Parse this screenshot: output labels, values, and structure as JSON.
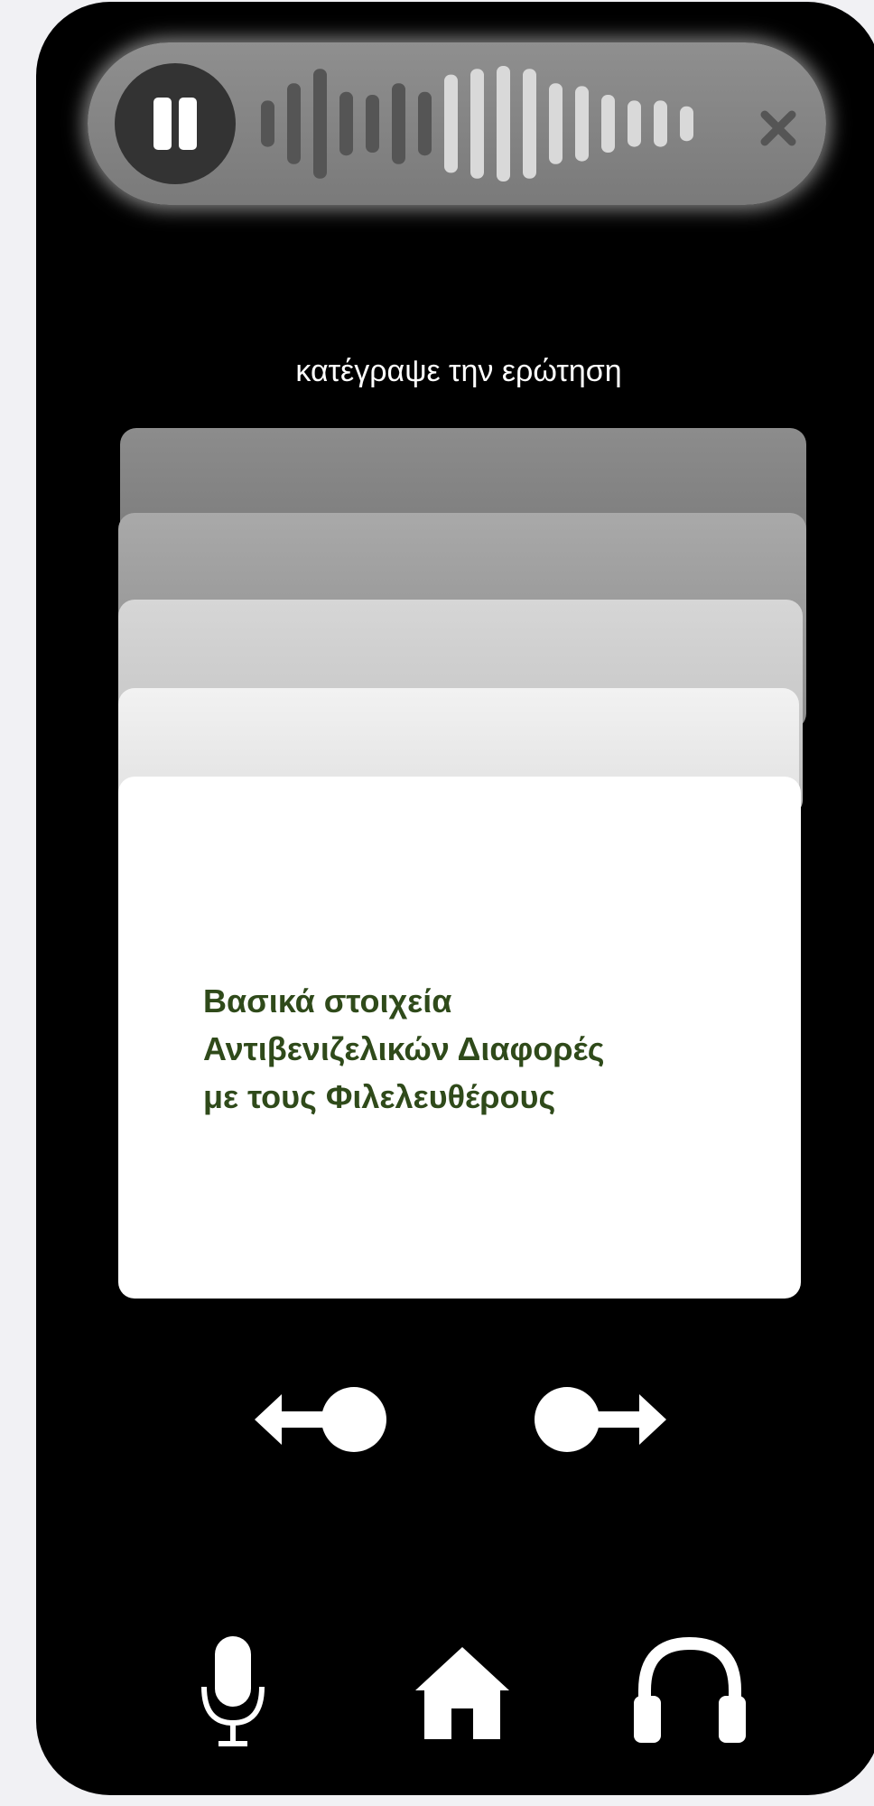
{
  "recorder": {
    "pause_icon": "pause-icon",
    "close_icon": "close-icon",
    "waveform": {
      "bars": [
        {
          "h": 0.4,
          "c": "#555555"
        },
        {
          "h": 0.7,
          "c": "#555555"
        },
        {
          "h": 0.95,
          "c": "#555555"
        },
        {
          "h": 0.55,
          "c": "#555555"
        },
        {
          "h": 0.5,
          "c": "#555555"
        },
        {
          "h": 0.7,
          "c": "#555555"
        },
        {
          "h": 0.55,
          "c": "#555555"
        },
        {
          "h": 0.85,
          "c": "#d9d9d9"
        },
        {
          "h": 0.95,
          "c": "#d9d9d9"
        },
        {
          "h": 1.0,
          "c": "#d9d9d9"
        },
        {
          "h": 0.95,
          "c": "#d9d9d9"
        },
        {
          "h": 0.7,
          "c": "#d9d9d9"
        },
        {
          "h": 0.65,
          "c": "#d9d9d9"
        },
        {
          "h": 0.5,
          "c": "#d9d9d9"
        },
        {
          "h": 0.4,
          "c": "#d9d9d9"
        },
        {
          "h": 0.4,
          "c": "#d9d9d9"
        },
        {
          "h": 0.3,
          "c": "#d9d9d9"
        }
      ]
    }
  },
  "prompt_text": "κατέγραψε την ερώτηση",
  "card": {
    "lines": [
      "Βασικά στοιχεία",
      "Αντιβενιζελικών Διαφορές",
      "με τους Φιλελευθέρους"
    ]
  },
  "navigation": {
    "prev_icon": "arrow-left-icon",
    "next_icon": "arrow-right-icon"
  },
  "bottom_bar": {
    "icons": [
      "microphone-icon",
      "home-icon",
      "headphones-icon"
    ]
  },
  "colors": {
    "card_text": "#2f4a1a",
    "background": "#000000",
    "recorder": "#858585"
  }
}
